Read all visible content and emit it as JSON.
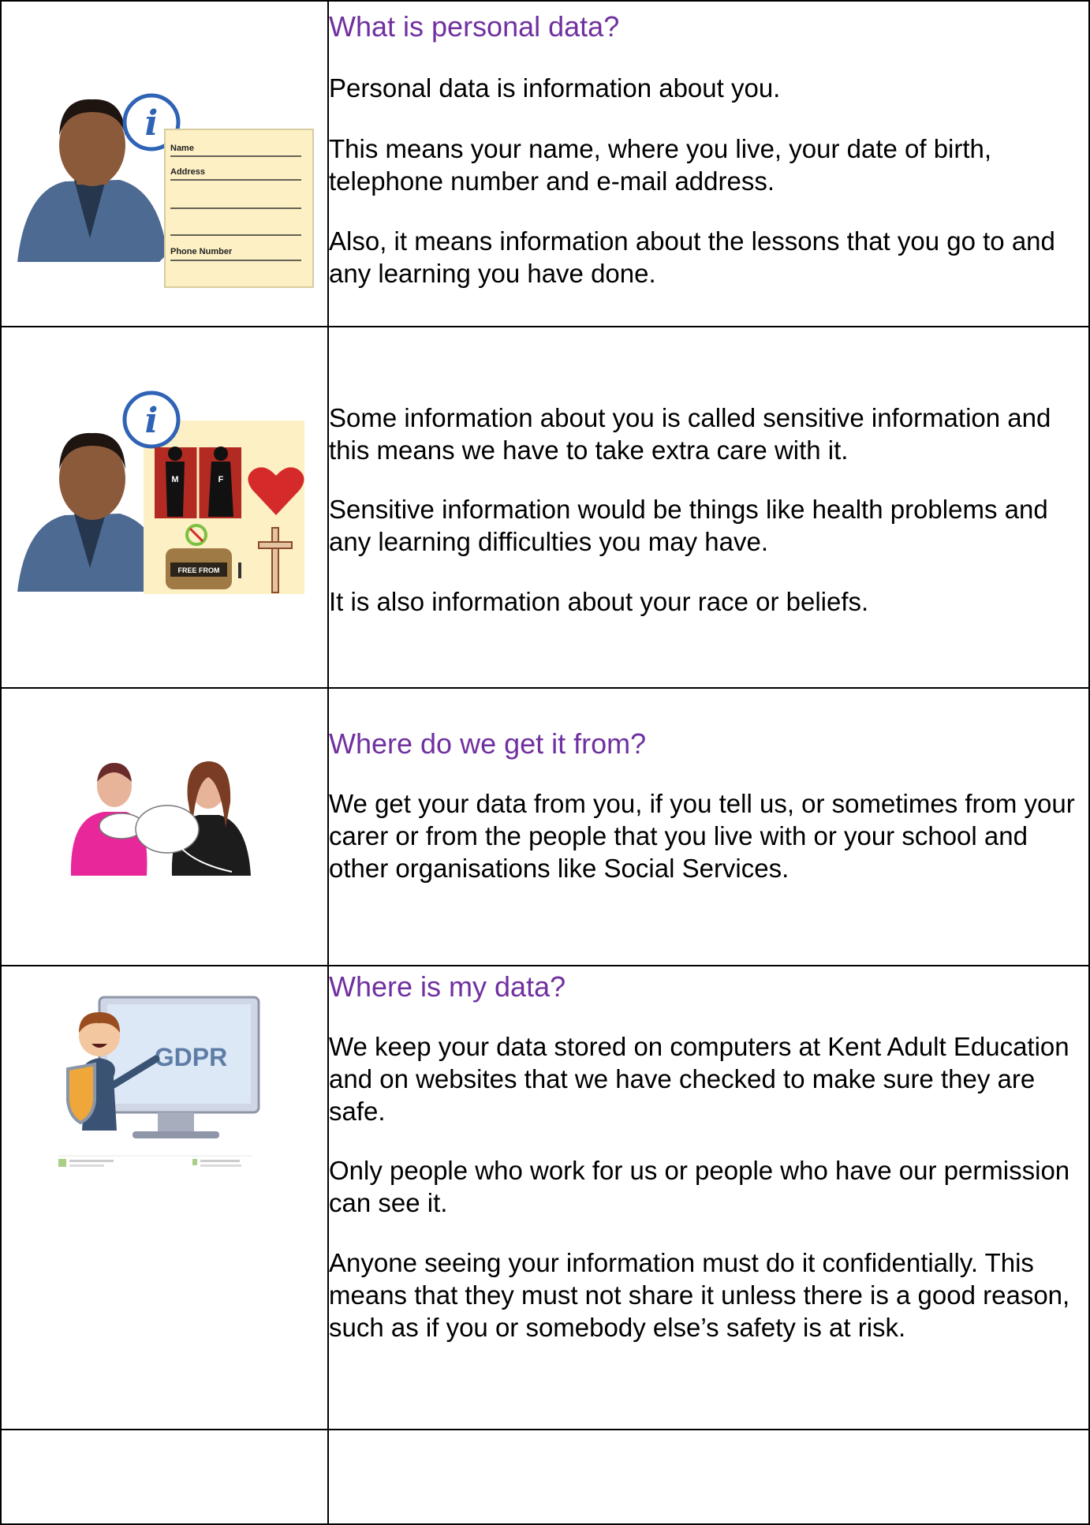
{
  "sections": [
    {
      "heading": "What is personal data?",
      "paragraphs": [
        "Personal data is information about you.",
        "This means your name, where you live, your date of birth, telephone number and e-mail address.",
        "Also, it means information about the lessons that you go to and any learning you have done."
      ],
      "image": {
        "icon": "info-icon",
        "form_labels": [
          "Name",
          "Address",
          "Phone Number"
        ]
      }
    },
    {
      "heading": "",
      "paragraphs": [
        "Some information about you is called sensitive information and this means we have to take extra care with it.",
        "Sensitive information would be things like health problems and any learning difficulties you may have.",
        "It is also information about your race or beliefs."
      ],
      "image": {
        "icon": "info-icon",
        "gender_labels": [
          "M",
          "F"
        ],
        "food_label": "FREE FROM"
      }
    },
    {
      "heading": "Where do we get it from?",
      "paragraphs": [
        "We get your data from you, if you tell us, or sometimes from your carer or from the people that you live with or your school and other organisations like Social Services."
      ]
    },
    {
      "heading": "Where is my data?",
      "paragraphs": [
        "We keep your data stored on computers at Kent Adult Education and on websites that we have checked to make sure they are safe.",
        "Only people who work for us or people who have our permission can see it.",
        "Anyone seeing your information must do it confidentially. This means that they must not share it unless there is a good reason, such as if you or somebody else’s safety is at risk."
      ],
      "image": {
        "screen_label": "GDPR"
      }
    }
  ],
  "colors": {
    "heading": "#7030a0",
    "border": "#000000"
  }
}
